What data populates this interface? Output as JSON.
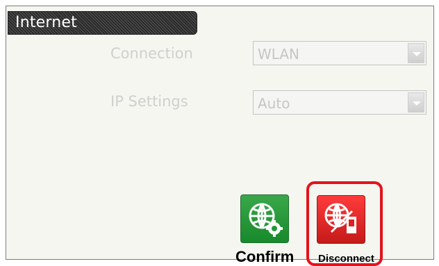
{
  "screen": {
    "title": "Internet"
  },
  "form": {
    "connection_label": "Connection",
    "connection_value": "WLAN",
    "ip_label": "IP Settings",
    "ip_value": "Auto"
  },
  "actions": {
    "confirm_label": "Confirm",
    "disconnect_label": "Disconnect"
  },
  "icons": {
    "confirm": "globe-gear-icon",
    "disconnect": "globe-device-icon",
    "dropdown": "chevron-down-icon"
  },
  "colors": {
    "confirm": "#1f9a36",
    "disconnect": "#e02020",
    "highlight": "#e3141b"
  }
}
